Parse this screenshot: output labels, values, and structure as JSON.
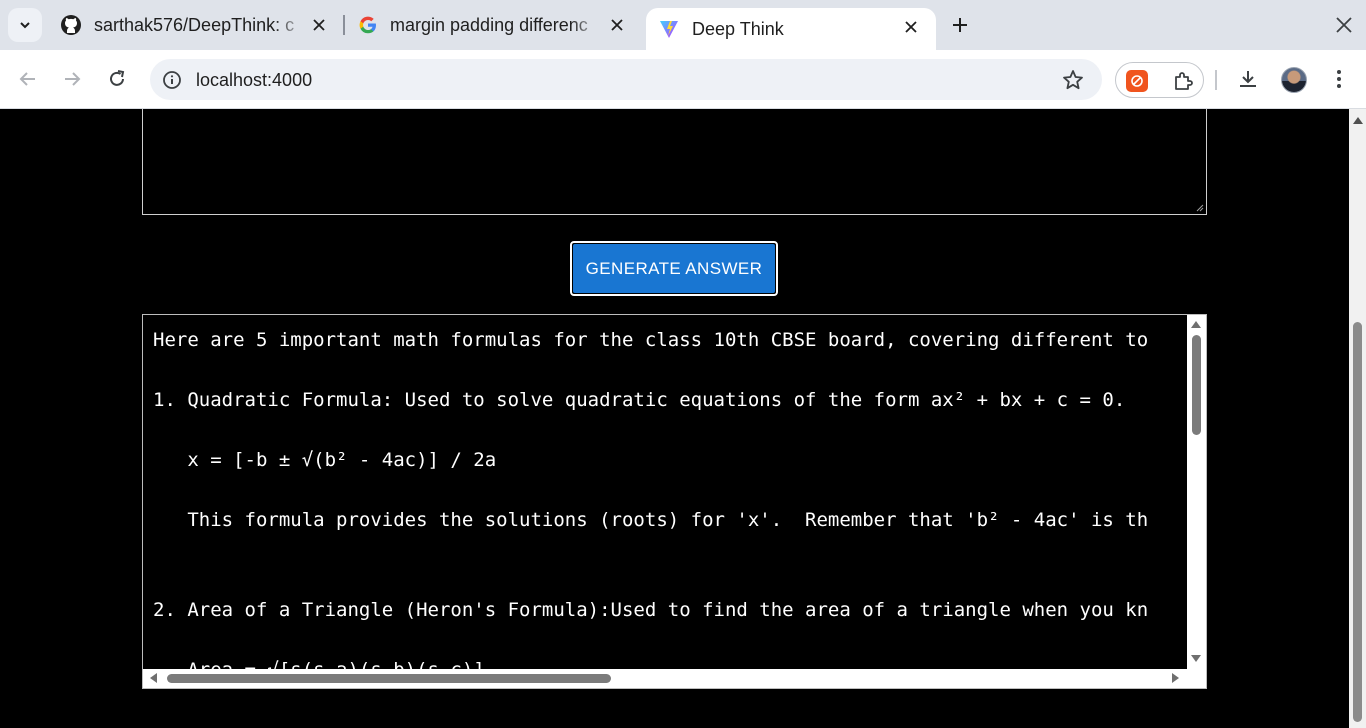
{
  "browser": {
    "tabs": [
      {
        "title": "sarthak576/DeepThink: c",
        "icon": "github-icon",
        "active": false
      },
      {
        "title": "margin padding differenc",
        "icon": "google-icon",
        "active": false
      },
      {
        "title": "Deep Think",
        "icon": "vite-icon",
        "active": true
      }
    ],
    "url": "localhost:4000"
  },
  "page": {
    "button_label": "GENERATE ANSWER",
    "answer_lines": [
      "Here are 5 important math formulas for the class 10th CBSE board, covering different to",
      "",
      "1. Quadratic Formula: Used to solve quadratic equations of the form ax² + bx + c = 0.",
      "",
      "   x = [-b ± √(b² - 4ac)] / 2a",
      "",
      "   This formula provides the solutions (roots) for 'x'.  Remember that 'b² - 4ac' is th",
      "",
      "",
      "2. Area of a Triangle (Heron's Formula):Used to find the area of a triangle when you kn",
      "",
      "   Area = √[s(s-a)(s-b)(s-c)]"
    ]
  },
  "colors": {
    "accent_button": "#1976d2",
    "page_background": "#000000",
    "tabstrip": "#dfe3ea"
  }
}
